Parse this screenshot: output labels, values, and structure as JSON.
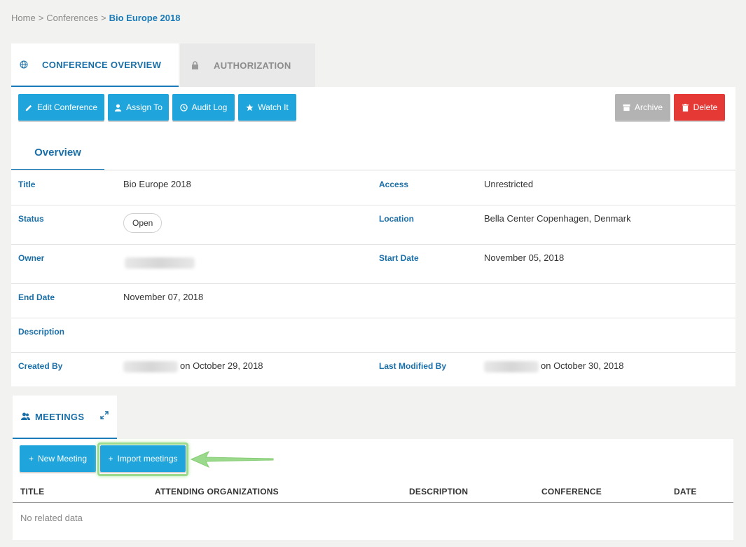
{
  "breadcrumb": {
    "home": "Home",
    "sep": ">",
    "conferences": "Conferences",
    "current": "Bio Europe 2018"
  },
  "tabs": {
    "overview": "CONFERENCE OVERVIEW",
    "authorization": "AUTHORIZATION"
  },
  "actions": {
    "edit": "Edit Conference",
    "assign": "Assign To",
    "audit": "Audit Log",
    "watch": "Watch It",
    "archive": "Archive",
    "delete": "Delete"
  },
  "subtab": "Overview",
  "fields": {
    "title_label": "Title",
    "title_value": "Bio Europe 2018",
    "access_label": "Access",
    "access_value": "Unrestricted",
    "status_label": "Status",
    "status_value": "Open",
    "location_label": "Location",
    "location_value": "Bella Center Copenhagen, Denmark",
    "owner_label": "Owner",
    "start_label": "Start Date",
    "start_value": "November 05, 2018",
    "end_label": "End Date",
    "end_value": "November 07, 2018",
    "description_label": "Description",
    "created_label": "Created By",
    "created_value": "on October 29, 2018",
    "modified_label": "Last Modified By",
    "modified_value": "on October 30, 2018"
  },
  "meetings": {
    "tab_label": "MEETINGS",
    "new_button": "New Meeting",
    "import_button": "Import meetings",
    "columns": [
      "TITLE",
      "ATTENDING ORGANIZATIONS",
      "DESCRIPTION",
      "CONFERENCE",
      "DATE"
    ],
    "empty": "No related data"
  },
  "colors": {
    "accent": "#1a7bb8",
    "button": "#1fa5dc",
    "danger": "#e53935",
    "highlight": "#9bd98c"
  }
}
